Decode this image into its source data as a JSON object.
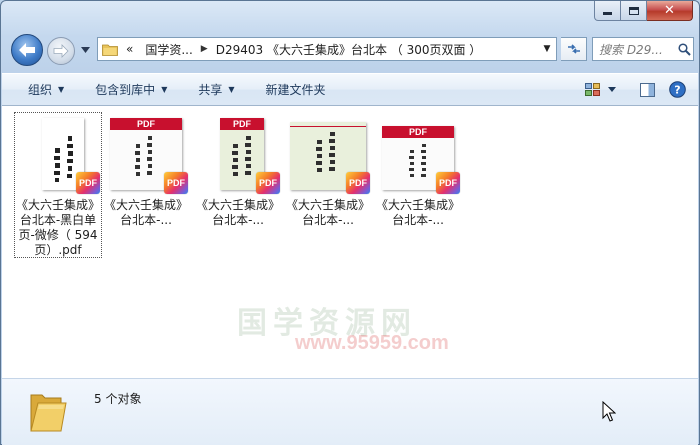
{
  "window": {
    "caption": {
      "minimize": "minimize",
      "maximize": "maximize",
      "close": "✕"
    }
  },
  "address": {
    "overflow": "«",
    "crumbs": [
      "国学资...",
      "D29403 《大六壬集成》台北本 （ 300页双面 ）"
    ]
  },
  "search": {
    "placeholder": "搜索 D29..."
  },
  "toolbar": {
    "organize": "组织",
    "include_in_library": "包含到库中",
    "share": "共享",
    "new_folder": "新建文件夹"
  },
  "files": [
    {
      "label": "《大六壬集成》台北本-黑白单页-微修（ 594页）.pdf",
      "selected": true
    },
    {
      "label": "《大六壬集成》台北本-..."
    },
    {
      "label": "《大六壬集成》台北本-..."
    },
    {
      "label": "《大六壬集成》台北本-..."
    },
    {
      "label": "《大六壬集成》台北本-..."
    }
  ],
  "thumbs": {
    "pdf_header": "PDF",
    "badge": "PDF"
  },
  "watermark": {
    "text": "国学资源网",
    "url": "www.95959.com"
  },
  "details": {
    "count": "5 个对象"
  },
  "colors": {
    "accent": "#1e395b",
    "pdf_red": "#c8102e",
    "window": "#bdd2ea"
  }
}
